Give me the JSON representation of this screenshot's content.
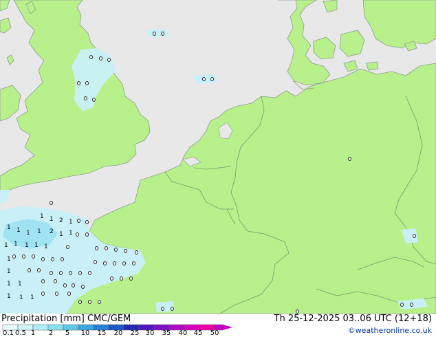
{
  "map": {
    "title": "Precipitation [mm]  CMC/GEM",
    "valid_time": "Th 25-12-2025 03..06 UTC (12+18)",
    "credit": "©weatheronline.co.uk",
    "colors": {
      "land": "#b8f08c",
      "sea": "#e8e8e8",
      "border": "#7a9a6a",
      "coast": "#8e9e8e",
      "precip_light": "#c8f0f8",
      "precip_moderate": "#a0e4f4"
    },
    "legend": {
      "labels": [
        "0.1",
        "0.5",
        "1",
        "2",
        "5",
        "10",
        "15",
        "20",
        "25",
        "30",
        "35",
        "40",
        "45",
        "50"
      ],
      "colors": [
        "#eaffff",
        "#cff6ff",
        "#aeeefa",
        "#88e0f2",
        "#5ec8ea",
        "#3aa8e0",
        "#2680d8",
        "#1c58c8",
        "#2828b8",
        "#5018c0",
        "#8010c8",
        "#b008c8",
        "#d800c0",
        "#f000a8",
        "#c800c8"
      ]
    },
    "station_labels": [
      {
        "id": "s1",
        "text": "1"
      },
      {
        "id": "s2",
        "text": "1"
      },
      {
        "id": "s3",
        "text": "2"
      },
      {
        "id": "s4",
        "text": "1"
      },
      {
        "id": "s5",
        "text": "1"
      },
      {
        "id": "s6",
        "text": "1"
      },
      {
        "id": "s7",
        "text": "1"
      },
      {
        "id": "s8",
        "text": "1"
      },
      {
        "id": "s9",
        "text": "2"
      },
      {
        "id": "s10",
        "text": "1"
      },
      {
        "id": "s11",
        "text": "1"
      },
      {
        "id": "s12",
        "text": "1"
      },
      {
        "id": "s13",
        "text": "1"
      },
      {
        "id": "s14",
        "text": "1"
      },
      {
        "id": "s15",
        "text": "1"
      },
      {
        "id": "s16",
        "text": "1"
      },
      {
        "id": "s17",
        "text": "1"
      },
      {
        "id": "s18",
        "text": "1"
      },
      {
        "id": "s19",
        "text": "1"
      },
      {
        "id": "s20",
        "text": "1"
      },
      {
        "id": "s21",
        "text": "1"
      },
      {
        "id": "s22",
        "text": "1"
      },
      {
        "id": "s23",
        "text": "1"
      }
    ]
  }
}
